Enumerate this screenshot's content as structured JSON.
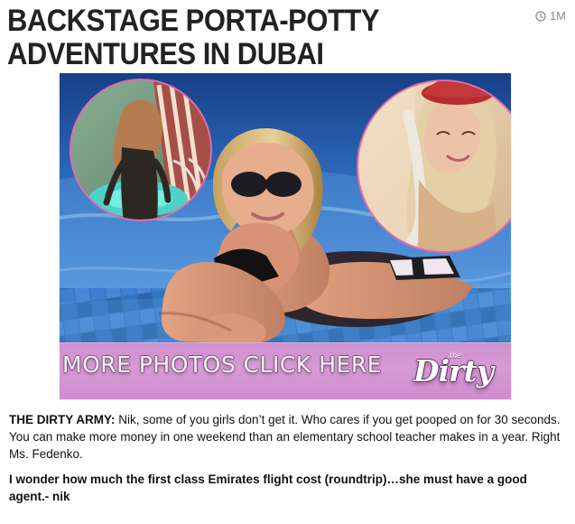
{
  "article": {
    "title": "BACKSTAGE PORTA-POTTY ADVENTURES IN DUBAI",
    "time_ago": "1M",
    "lead_label": "THE DIRTY ARMY:",
    "body": " Nik, some of you girls don’t get it. Who cares if you get pooped on for 30 seconds. You can make more money in one weekend than an elementary school teacher makes in a year. Right Ms. Fedenko.",
    "closing": "I wonder how much the first class Emirates flight cost (roundtrip)…she must have a good agent.- nik"
  },
  "hero": {
    "cta_text": "MORE PHOTOS CLICK HERE",
    "brand_small": "the",
    "brand_main": "Dirty"
  },
  "colors": {
    "title": "#222222",
    "meta": "#8a8a8a",
    "cta_band": "#d69bd5",
    "circle_border": "#e26ca8",
    "pool_blue": "#2b66b5"
  },
  "icons": {
    "time": "clock-icon",
    "hero_left": "pool-inset-photo",
    "hero_right": "portrait-inset-photo"
  }
}
